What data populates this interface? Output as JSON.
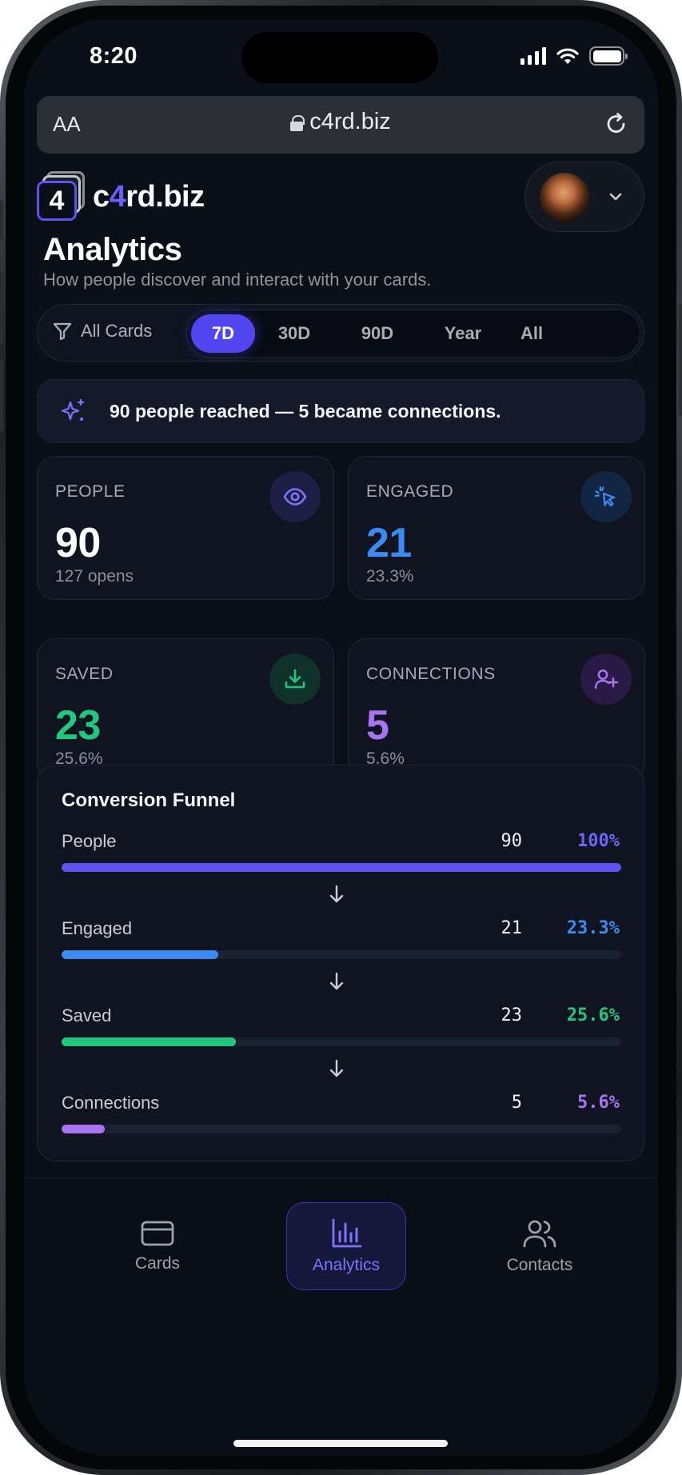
{
  "status_bar": {
    "time": "8:20"
  },
  "browser": {
    "text_size_label": "AA",
    "url": "c4rd.biz"
  },
  "header": {
    "logo_digit": "4",
    "brand_prefix": "c",
    "brand_accent": "4",
    "brand_suffix": "rd.biz"
  },
  "page": {
    "title": "Analytics",
    "subtitle": "How people discover and interact with your cards."
  },
  "filters": {
    "card_filter_label": "All Cards",
    "periods": [
      "7D",
      "30D",
      "90D",
      "Year",
      "All"
    ],
    "active_period": "7D"
  },
  "summary": {
    "text": "90 people reached — 5 became connections."
  },
  "stats": [
    {
      "label": "PEOPLE",
      "value": "90",
      "sub": "127 opens",
      "color": "#ffffff",
      "icon": "eye-icon"
    },
    {
      "label": "ENGAGED",
      "value": "21",
      "sub": "23.3%",
      "color": "#3b8cf2",
      "icon": "cursor-click-icon"
    },
    {
      "label": "SAVED",
      "value": "23",
      "sub": "25.6%",
      "color": "#22c77f",
      "icon": "download-icon"
    },
    {
      "label": "CONNECTIONS",
      "value": "5",
      "sub": "5.6%",
      "color": "#a974f0",
      "icon": "user-plus-icon"
    }
  ],
  "funnel": {
    "title": "Conversion Funnel",
    "rows": [
      {
        "label": "People",
        "count": "90",
        "pct": "100%",
        "fraction": 1.0,
        "color": "#5b52f0",
        "pct_color": "#6e64f5"
      },
      {
        "label": "Engaged",
        "count": "21",
        "pct": "23.3%",
        "fraction": 0.28,
        "color": "#3b8cf2",
        "pct_color": "#3b8cf2"
      },
      {
        "label": "Saved",
        "count": "23",
        "pct": "25.6%",
        "fraction": 0.312,
        "color": "#22c77f",
        "pct_color": "#22c77f"
      },
      {
        "label": "Connections",
        "count": "5",
        "pct": "5.6%",
        "fraction": 0.077,
        "color": "#a974f0",
        "pct_color": "#a974f0"
      }
    ]
  },
  "nav": {
    "items": [
      {
        "label": "Cards",
        "icon": "card-icon"
      },
      {
        "label": "Analytics",
        "icon": "bar-chart-icon"
      },
      {
        "label": "Contacts",
        "icon": "users-icon"
      }
    ],
    "active": "Analytics"
  }
}
